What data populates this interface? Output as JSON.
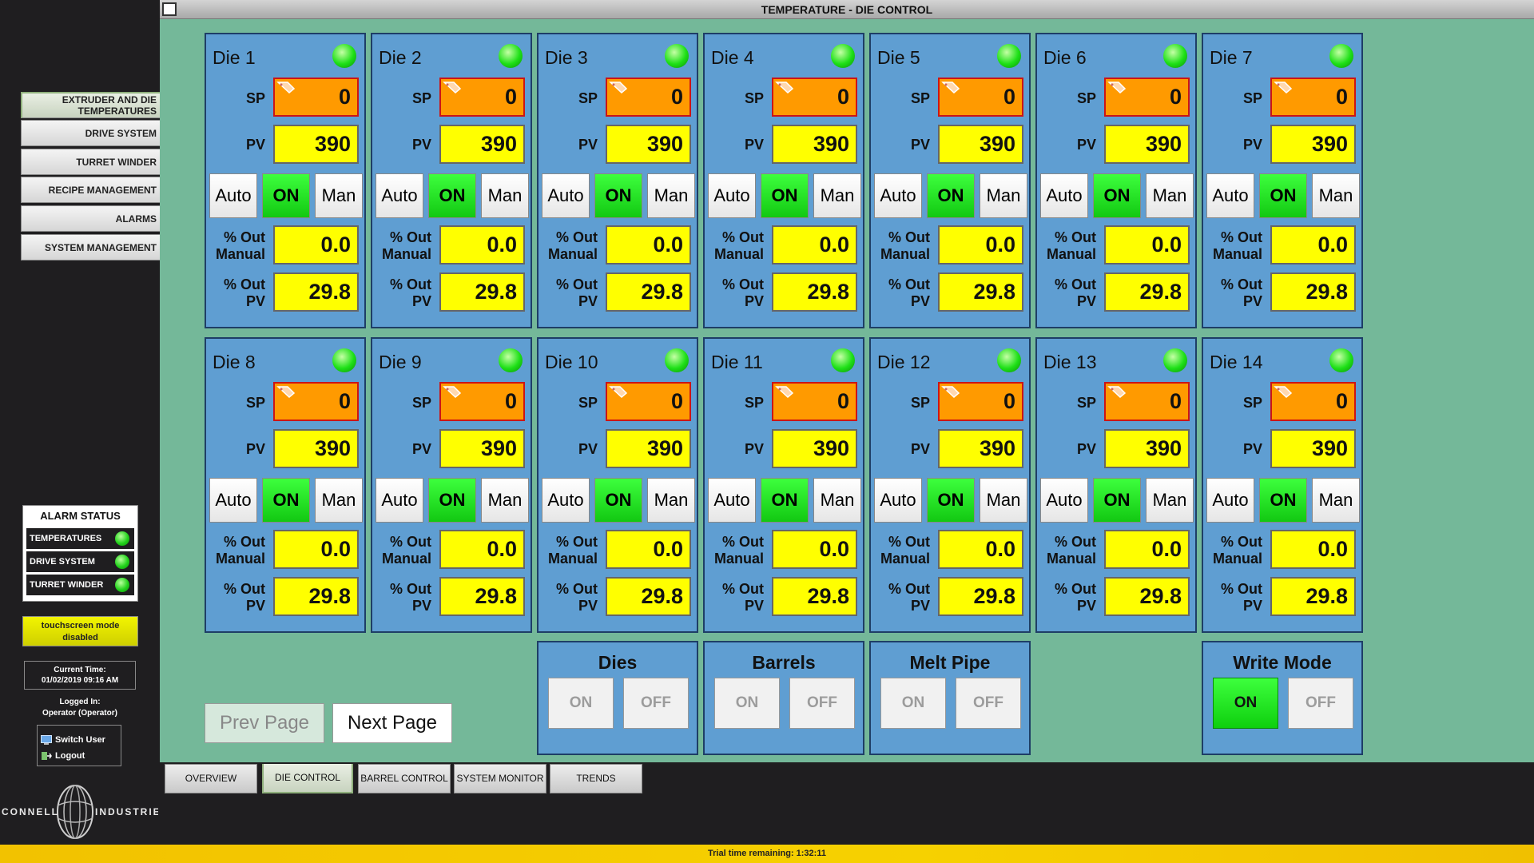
{
  "window": {
    "title": "TEMPERATURE - DIE CONTROL"
  },
  "nav": [
    {
      "label": "EXTRUDER AND DIE TEMPERATURES",
      "active": true
    },
    {
      "label": "DRIVE SYSTEM"
    },
    {
      "label": "TURRET WINDER"
    },
    {
      "label": "RECIPE MANAGEMENT"
    },
    {
      "label": "ALARMS"
    },
    {
      "label": "SYSTEM MANAGEMENT"
    }
  ],
  "alarm_status": {
    "title": "ALARM STATUS",
    "items": [
      {
        "label": "TEMPERATURES",
        "status_color": "#22d21b"
      },
      {
        "label": "DRIVE SYSTEM",
        "status_color": "#22d21b"
      },
      {
        "label": "TURRET WINDER",
        "status_color": "#22d21b"
      }
    ]
  },
  "touchscreen": {
    "label": "touchscreen mode disabled"
  },
  "clock": {
    "label": "Current Time:",
    "value": "01/02/2019 09:16 AM"
  },
  "login": {
    "label": "Logged In:",
    "user": "Operator (Operator)",
    "switch_user": "Switch User",
    "logout": "Logout"
  },
  "logo": {
    "left": "CONNELL",
    "right": "INDUSTRIES"
  },
  "labels": {
    "sp": "SP",
    "pv": "PV",
    "auto": "Auto",
    "on": "ON",
    "man": "Man",
    "out_manual_1": "% Out",
    "out_manual_2": "Manual",
    "out_pv_1": "% Out",
    "out_pv_2": "PV"
  },
  "dies": [
    {
      "name": "Die 1",
      "sp": "0",
      "pv": "390",
      "out_manual": "0.0",
      "out_pv": "29.8"
    },
    {
      "name": "Die 2",
      "sp": "0",
      "pv": "390",
      "out_manual": "0.0",
      "out_pv": "29.8"
    },
    {
      "name": "Die 3",
      "sp": "0",
      "pv": "390",
      "out_manual": "0.0",
      "out_pv": "29.8"
    },
    {
      "name": "Die 4",
      "sp": "0",
      "pv": "390",
      "out_manual": "0.0",
      "out_pv": "29.8"
    },
    {
      "name": "Die 5",
      "sp": "0",
      "pv": "390",
      "out_manual": "0.0",
      "out_pv": "29.8"
    },
    {
      "name": "Die 6",
      "sp": "0",
      "pv": "390",
      "out_manual": "0.0",
      "out_pv": "29.8"
    },
    {
      "name": "Die 7",
      "sp": "0",
      "pv": "390",
      "out_manual": "0.0",
      "out_pv": "29.8"
    },
    {
      "name": "Die 8",
      "sp": "0",
      "pv": "390",
      "out_manual": "0.0",
      "out_pv": "29.8"
    },
    {
      "name": "Die 9",
      "sp": "0",
      "pv": "390",
      "out_manual": "0.0",
      "out_pv": "29.8"
    },
    {
      "name": "Die 10",
      "sp": "0",
      "pv": "390",
      "out_manual": "0.0",
      "out_pv": "29.8"
    },
    {
      "name": "Die 11",
      "sp": "0",
      "pv": "390",
      "out_manual": "0.0",
      "out_pv": "29.8"
    },
    {
      "name": "Die 12",
      "sp": "0",
      "pv": "390",
      "out_manual": "0.0",
      "out_pv": "29.8"
    },
    {
      "name": "Die 13",
      "sp": "0",
      "pv": "390",
      "out_manual": "0.0",
      "out_pv": "29.8"
    },
    {
      "name": "Die 14",
      "sp": "0",
      "pv": "390",
      "out_manual": "0.0",
      "out_pv": "29.8"
    }
  ],
  "groups": [
    {
      "title": "Dies",
      "on": "ON",
      "off": "OFF",
      "active": "none"
    },
    {
      "title": "Barrels",
      "on": "ON",
      "off": "OFF",
      "active": "none"
    },
    {
      "title": "Melt Pipe",
      "on": "ON",
      "off": "OFF",
      "active": "none"
    },
    {
      "title": "Write Mode",
      "on": "ON",
      "off": "OFF",
      "active": "on"
    }
  ],
  "paging": {
    "prev": "Prev Page",
    "next": "Next Page",
    "prev_enabled": false
  },
  "tabs": [
    {
      "label": "OVERVIEW"
    },
    {
      "label": "DIE CONTROL",
      "active": true
    },
    {
      "label": "BARREL CONTROL"
    },
    {
      "label": "SYSTEM MONITOR"
    },
    {
      "label": "TRENDS"
    }
  ],
  "footer": {
    "text": "Trial time remaining: 1:32:11"
  },
  "colors": {
    "panel_bg": "#74b899",
    "die_bg": "#5f9ed2",
    "sp_bg": "#ff9a00",
    "value_bg": "#ffff00",
    "on_green": "#22d21b"
  }
}
